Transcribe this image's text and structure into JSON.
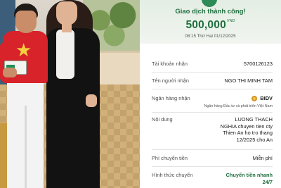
{
  "receipt": {
    "status_title": "Giao dịch thành công!",
    "amount": "500,000",
    "currency": "VND",
    "datetime": "08:15 Thứ Hai 01/12/2025",
    "fields": {
      "account_label": "Tài khoản nhận",
      "account_value": "5700126123",
      "receiver_label": "Tên người nhận",
      "receiver_value": "NGO THI MINH TAM",
      "bank_label": "Ngân hàng nhận",
      "bank_value": "BIDV",
      "bank_fullname": "Ngân hàng Đầu tư và phát triển Việt Nam",
      "content_label": "Nội dung",
      "content_value": "LUONG THACH NGHIA chuyen tien cty Thien An ho tro thang 12/2025 cho An",
      "fee_label": "Phí chuyển tiền",
      "fee_value": "Miễn phí",
      "method_label": "Hình thức chuyển",
      "method_value": "Chuyển tiền nhanh 24/7"
    }
  },
  "colors": {
    "accent_green": "#1f6e3f",
    "header_bg": "#e4eee4",
    "shirt_red": "#d8232a"
  }
}
